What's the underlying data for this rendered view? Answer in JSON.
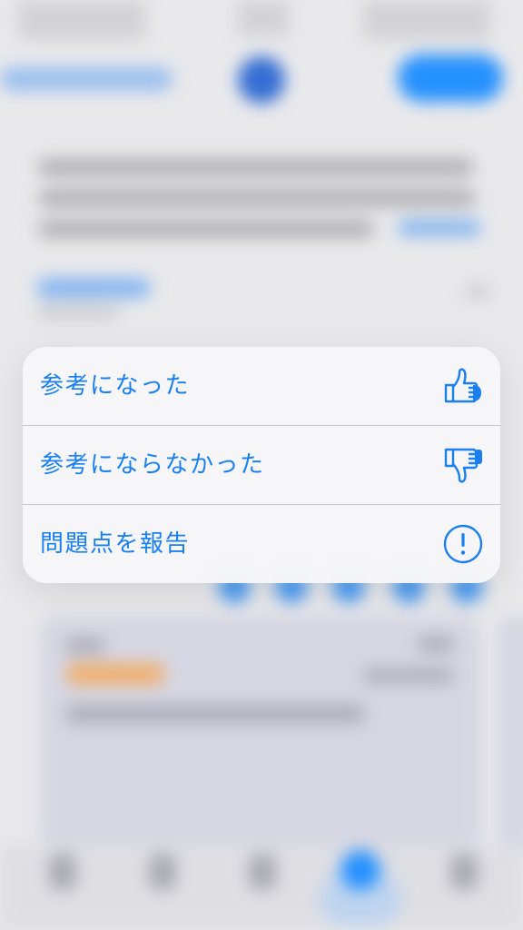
{
  "theme": {
    "accent": "#1a7ff0"
  },
  "context_menu": {
    "items": [
      {
        "label": "参考になった",
        "icon": "thumbs-up-icon"
      },
      {
        "label": "参考にならなかった",
        "icon": "thumbs-down-icon"
      },
      {
        "label": "問題点を報告",
        "icon": "exclamation-circle-icon"
      }
    ]
  }
}
